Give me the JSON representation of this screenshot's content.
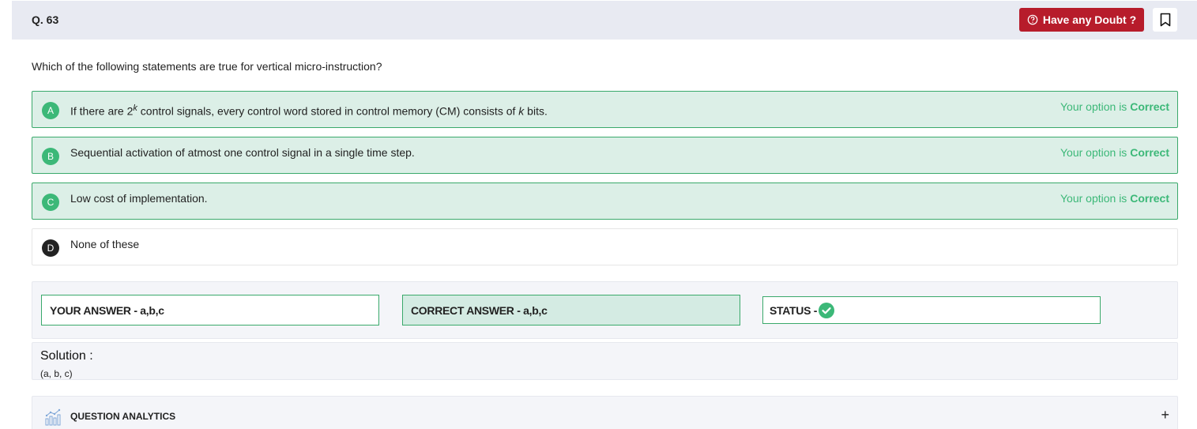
{
  "question": {
    "number_label": "Q. 63",
    "text": "Which of the following statements are true for vertical micro-instruction?"
  },
  "header": {
    "doubt_button_label": "Have any Doubt ?",
    "bookmark_icon": "bookmark-icon"
  },
  "options": [
    {
      "letter": "A",
      "text_before_sup": "If there are 2",
      "sup": "k",
      "text_after_sup": " control signals, every control word stored in control memory (CM) consists of ",
      "italic": "k",
      "text_end": " bits.",
      "status_prefix": "Your option is ",
      "status_word": "Correct"
    },
    {
      "letter": "B",
      "text": "Sequential activation of atmost one control signal in a single time step.",
      "status_prefix": "Your option is ",
      "status_word": "Correct"
    },
    {
      "letter": "C",
      "text": "Low cost of implementation.",
      "status_prefix": "Your option is ",
      "status_word": "Correct"
    },
    {
      "letter": "D",
      "text": "None of these"
    }
  ],
  "answers": {
    "your_answer": "YOUR ANSWER - a,b,c",
    "correct_answer": "CORRECT ANSWER - a,b,c",
    "status_label": "STATUS -",
    "status_icon": "check-circle-icon"
  },
  "solution": {
    "title": "Solution :",
    "body": "(a, b, c)"
  },
  "analytics": {
    "label": "QUESTION ANALYTICS",
    "expand_symbol": "+"
  },
  "colors": {
    "accent_green": "#3cb878",
    "doubt_red": "#b71c2b",
    "header_bg": "#e8eaf2"
  }
}
